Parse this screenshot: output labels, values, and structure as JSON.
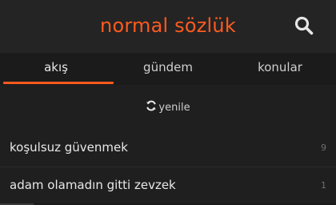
{
  "header": {
    "title": "normal sözlük",
    "search_icon": "search-icon"
  },
  "colors": {
    "accent": "#ff5a1f",
    "background": "#1f1f1f",
    "header_bg": "#242424",
    "text": "#e8e8e8",
    "muted": "#707070"
  },
  "tabs": [
    {
      "label": "akış",
      "active": true
    },
    {
      "label": "gündem",
      "active": false
    },
    {
      "label": "konular",
      "active": false
    }
  ],
  "refresh": {
    "icon": "refresh-icon",
    "label": "yenile"
  },
  "entries": [
    {
      "title": "koşulsuz güvenmek",
      "count": "9"
    },
    {
      "title": "adam olamadın gitti zevzek",
      "count": "1"
    }
  ]
}
